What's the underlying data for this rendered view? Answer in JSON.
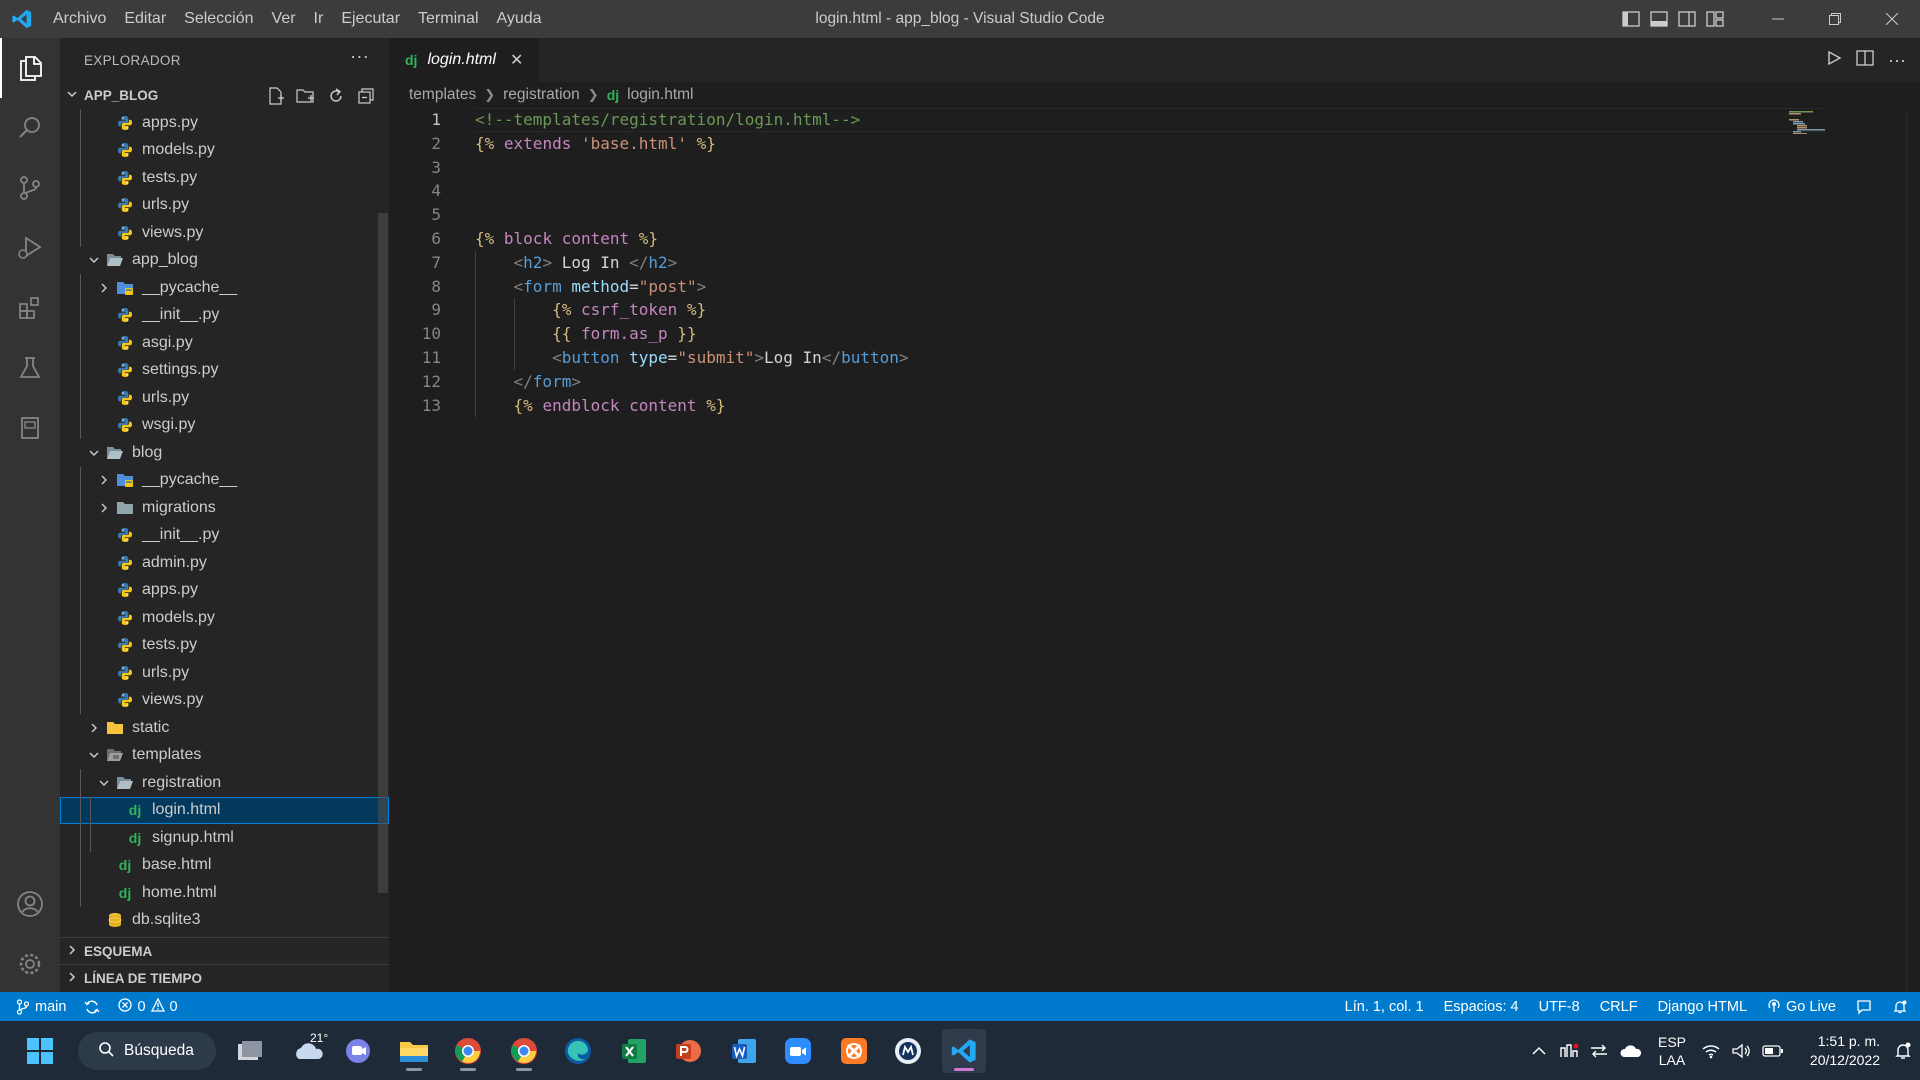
{
  "window": {
    "title": "login.html - app_blog - Visual Studio Code",
    "menu": [
      "Archivo",
      "Editar",
      "Selección",
      "Ver",
      "Ir",
      "Ejecutar",
      "Terminal",
      "Ayuda"
    ]
  },
  "sidebar": {
    "header": "EXPLORADOR",
    "root_section": "APP_BLOG",
    "tree": [
      {
        "label": "apps.py",
        "type": "py",
        "level": 1
      },
      {
        "label": "models.py",
        "type": "py",
        "level": 1
      },
      {
        "label": "tests.py",
        "type": "py",
        "level": 1
      },
      {
        "label": "urls.py",
        "type": "py",
        "level": 1
      },
      {
        "label": "views.py",
        "type": "py",
        "level": 1
      },
      {
        "label": "app_blog",
        "type": "folder-open",
        "level": 0
      },
      {
        "label": "__pycache__",
        "type": "folder-closed-blue",
        "level": 1
      },
      {
        "label": "__init__.py",
        "type": "py",
        "level": 1
      },
      {
        "label": "asgi.py",
        "type": "py",
        "level": 1
      },
      {
        "label": "settings.py",
        "type": "py",
        "level": 1
      },
      {
        "label": "urls.py",
        "type": "py",
        "level": 1
      },
      {
        "label": "wsgi.py",
        "type": "py",
        "level": 1
      },
      {
        "label": "blog",
        "type": "folder-open",
        "level": 0
      },
      {
        "label": "__pycache__",
        "type": "folder-closed-blue",
        "level": 1
      },
      {
        "label": "migrations",
        "type": "folder-closed",
        "level": 1
      },
      {
        "label": "__init__.py",
        "type": "py",
        "level": 1
      },
      {
        "label": "admin.py",
        "type": "py",
        "level": 1
      },
      {
        "label": "apps.py",
        "type": "py",
        "level": 1
      },
      {
        "label": "models.py",
        "type": "py",
        "level": 1
      },
      {
        "label": "tests.py",
        "type": "py",
        "level": 1
      },
      {
        "label": "urls.py",
        "type": "py",
        "level": 1
      },
      {
        "label": "views.py",
        "type": "py",
        "level": 1
      },
      {
        "label": "static",
        "type": "folder-static",
        "level": 0
      },
      {
        "label": "templates",
        "type": "folder-open-templates",
        "level": 0
      },
      {
        "label": "registration",
        "type": "folder-open",
        "level": 1
      },
      {
        "label": "login.html",
        "type": "dj",
        "level": 2,
        "selected": true
      },
      {
        "label": "signup.html",
        "type": "dj",
        "level": 2
      },
      {
        "label": "base.html",
        "type": "dj",
        "level": 1
      },
      {
        "label": "home.html",
        "type": "dj",
        "level": 1
      },
      {
        "label": "db.sqlite3",
        "type": "db",
        "level": 0
      }
    ],
    "outline_section": "ESQUEMA",
    "timeline_section": "LÍNEA DE TIEMPO"
  },
  "editor": {
    "tab_icon": "dj",
    "tab_label": "login.html",
    "breadcrumb": [
      "templates",
      "registration",
      "login.html"
    ],
    "lines": [
      [
        {
          "t": "<!--templates/registration/login.html-->",
          "c": "c-comment"
        }
      ],
      [
        {
          "t": "{% ",
          "c": "c-tmpl"
        },
        {
          "t": "extends",
          "c": "c-kw"
        },
        {
          "t": " ",
          "c": "c-text"
        },
        {
          "t": "'base.html'",
          "c": "c-str"
        },
        {
          "t": " %}",
          "c": "c-tmpl"
        }
      ],
      [],
      [],
      [],
      [
        {
          "t": "{% ",
          "c": "c-tmpl"
        },
        {
          "t": "block",
          "c": "c-kw"
        },
        {
          "t": " content",
          "c": "c-kw"
        },
        {
          "t": " %}",
          "c": "c-tmpl"
        }
      ],
      [
        {
          "t": "    ",
          "c": "c-text"
        },
        {
          "t": "<",
          "c": "c-punc"
        },
        {
          "t": "h2",
          "c": "c-tag"
        },
        {
          "t": ">",
          "c": "c-punc"
        },
        {
          "t": " Log In ",
          "c": "c-text"
        },
        {
          "t": "</",
          "c": "c-punc"
        },
        {
          "t": "h2",
          "c": "c-tag"
        },
        {
          "t": ">",
          "c": "c-punc"
        }
      ],
      [
        {
          "t": "    ",
          "c": "c-text"
        },
        {
          "t": "<",
          "c": "c-punc"
        },
        {
          "t": "form",
          "c": "c-tag"
        },
        {
          "t": " ",
          "c": "c-text"
        },
        {
          "t": "method",
          "c": "c-attr"
        },
        {
          "t": "=",
          "c": "c-text"
        },
        {
          "t": "\"post\"",
          "c": "c-str"
        },
        {
          "t": ">",
          "c": "c-punc"
        }
      ],
      [
        {
          "t": "        ",
          "c": "c-text"
        },
        {
          "t": "{% ",
          "c": "c-tmpl"
        },
        {
          "t": "csrf_token",
          "c": "c-kw"
        },
        {
          "t": " %}",
          "c": "c-tmpl"
        }
      ],
      [
        {
          "t": "        ",
          "c": "c-text"
        },
        {
          "t": "{{ ",
          "c": "c-tmpl"
        },
        {
          "t": "form.as_p",
          "c": "c-kw"
        },
        {
          "t": " }}",
          "c": "c-tmpl"
        }
      ],
      [
        {
          "t": "        ",
          "c": "c-text"
        },
        {
          "t": "<",
          "c": "c-punc"
        },
        {
          "t": "button",
          "c": "c-tag"
        },
        {
          "t": " ",
          "c": "c-text"
        },
        {
          "t": "type",
          "c": "c-attr"
        },
        {
          "t": "=",
          "c": "c-text"
        },
        {
          "t": "\"submit\"",
          "c": "c-str"
        },
        {
          "t": ">",
          "c": "c-punc"
        },
        {
          "t": "Log In",
          "c": "c-text"
        },
        {
          "t": "</",
          "c": "c-punc"
        },
        {
          "t": "button",
          "c": "c-tag"
        },
        {
          "t": ">",
          "c": "c-punc"
        }
      ],
      [
        {
          "t": "    ",
          "c": "c-text"
        },
        {
          "t": "</",
          "c": "c-punc"
        },
        {
          "t": "form",
          "c": "c-tag"
        },
        {
          "t": ">",
          "c": "c-punc"
        }
      ],
      [
        {
          "t": "    ",
          "c": "c-text"
        },
        {
          "t": "{% ",
          "c": "c-tmpl"
        },
        {
          "t": "endblock",
          "c": "c-kw"
        },
        {
          "t": " content",
          "c": "c-kw"
        },
        {
          "t": " %}",
          "c": "c-tmpl"
        }
      ]
    ]
  },
  "statusbar": {
    "branch": "main",
    "errors": "0",
    "warnings": "0",
    "position": "Lín. 1, col. 1",
    "spaces": "Espacios: 4",
    "encoding": "UTF-8",
    "eol": "CRLF",
    "language": "Django HTML",
    "golive": "Go Live"
  },
  "taskbar": {
    "search": "Búsqueda",
    "weather": "21°",
    "lang_top": "ESP",
    "lang_bottom": "LAA",
    "time": "1:51 p. m.",
    "date": "20/12/2022"
  },
  "colors": {
    "accent": "#007acc",
    "selection": "#04395e",
    "django": "#2fb45a"
  }
}
